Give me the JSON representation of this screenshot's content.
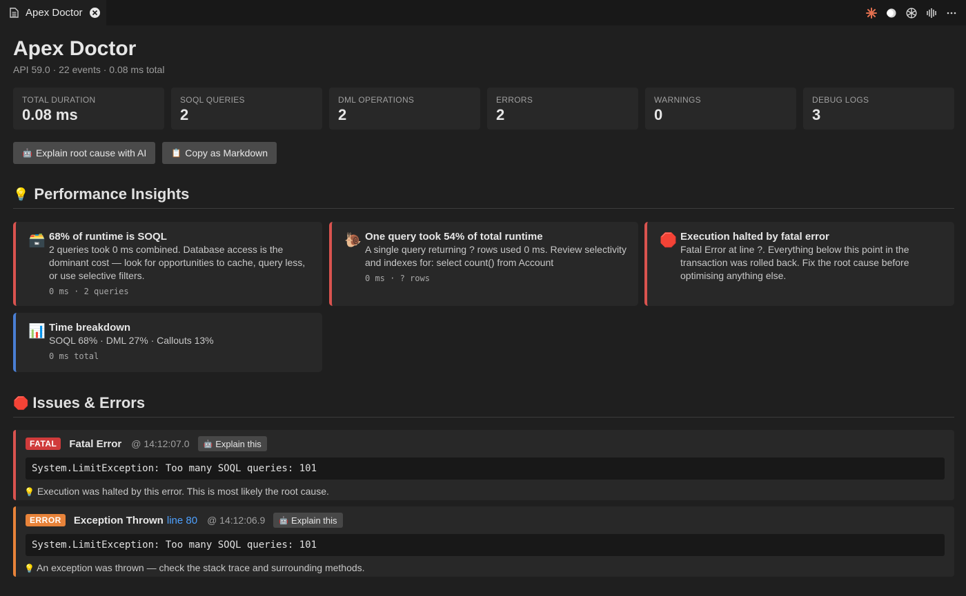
{
  "tab": {
    "label": "Apex Doctor",
    "doc_icon": "file-icon",
    "close_icon": "close-icon"
  },
  "tab_actions": [
    {
      "icon": "sparkle-icon"
    },
    {
      "icon": "record-icon"
    },
    {
      "icon": "openai-icon"
    },
    {
      "icon": "split-editor-icon"
    },
    {
      "icon": "more-icon"
    }
  ],
  "header": {
    "title": "Apex Doctor",
    "subtitle": "API 59.0 · 22 events · 0.08 ms total"
  },
  "stats": [
    {
      "label": "TOTAL DURATION",
      "value": "0.08 ms"
    },
    {
      "label": "SOQL QUERIES",
      "value": "2"
    },
    {
      "label": "DML OPERATIONS",
      "value": "2"
    },
    {
      "label": "ERRORS",
      "value": "2"
    },
    {
      "label": "WARNINGS",
      "value": "0"
    },
    {
      "label": "DEBUG LOGS",
      "value": "3"
    }
  ],
  "actions": {
    "explain_label": "Explain root cause with AI",
    "copy_label": "Copy as Markdown"
  },
  "insights_section": {
    "title": "Performance Insights",
    "items": [
      {
        "title": "68% of runtime is SOQL",
        "desc": "2 queries took 0 ms combined. Database access is the dominant cost — look for opportunities to cache, query less, or use selective filters.",
        "meta": "0 ms · 2 queries",
        "icon": "file-cabinet-icon"
      },
      {
        "title": "One query took 54% of total runtime",
        "desc": "A single query returning ? rows used 0 ms. Review selectivity and indexes for: select count() from Account",
        "meta": "0 ms · ? rows",
        "icon": "snail-icon"
      },
      {
        "title": "Execution halted by fatal error",
        "desc": "Fatal Error at line ?. Everything below this point in the transaction was rolled back. Fix the root cause before optimising anything else.",
        "meta": "",
        "icon": "stop-icon"
      },
      {
        "title": "Time breakdown",
        "desc": "SOQL 68% · DML 27% · Callouts 13%",
        "meta": "0 ms total",
        "icon": "bar-chart-icon"
      }
    ]
  },
  "issues_section": {
    "title": "Issues & Errors",
    "items": [
      {
        "badge": "FATAL",
        "title": "Fatal Error",
        "line": "",
        "time": "@ 14:12:07.0",
        "explain_label": "Explain this",
        "code": "System.LimitException: Too many SOQL queries: 101",
        "note": "Execution was halted by this error. This is most likely the root cause."
      },
      {
        "badge": "ERROR",
        "title": "Exception Thrown",
        "line": "line 80",
        "time": "@ 14:12:06.9",
        "explain_label": "Explain this",
        "code": "System.LimitException: Too many SOQL queries: 101",
        "note": "An exception was thrown — check the stack trace and surrounding methods."
      }
    ]
  },
  "colors": {
    "red_accent": "#d9534f",
    "orange_accent": "#e8833a",
    "blue_accent": "#4a7fd4",
    "link": "#4ea1ff"
  }
}
